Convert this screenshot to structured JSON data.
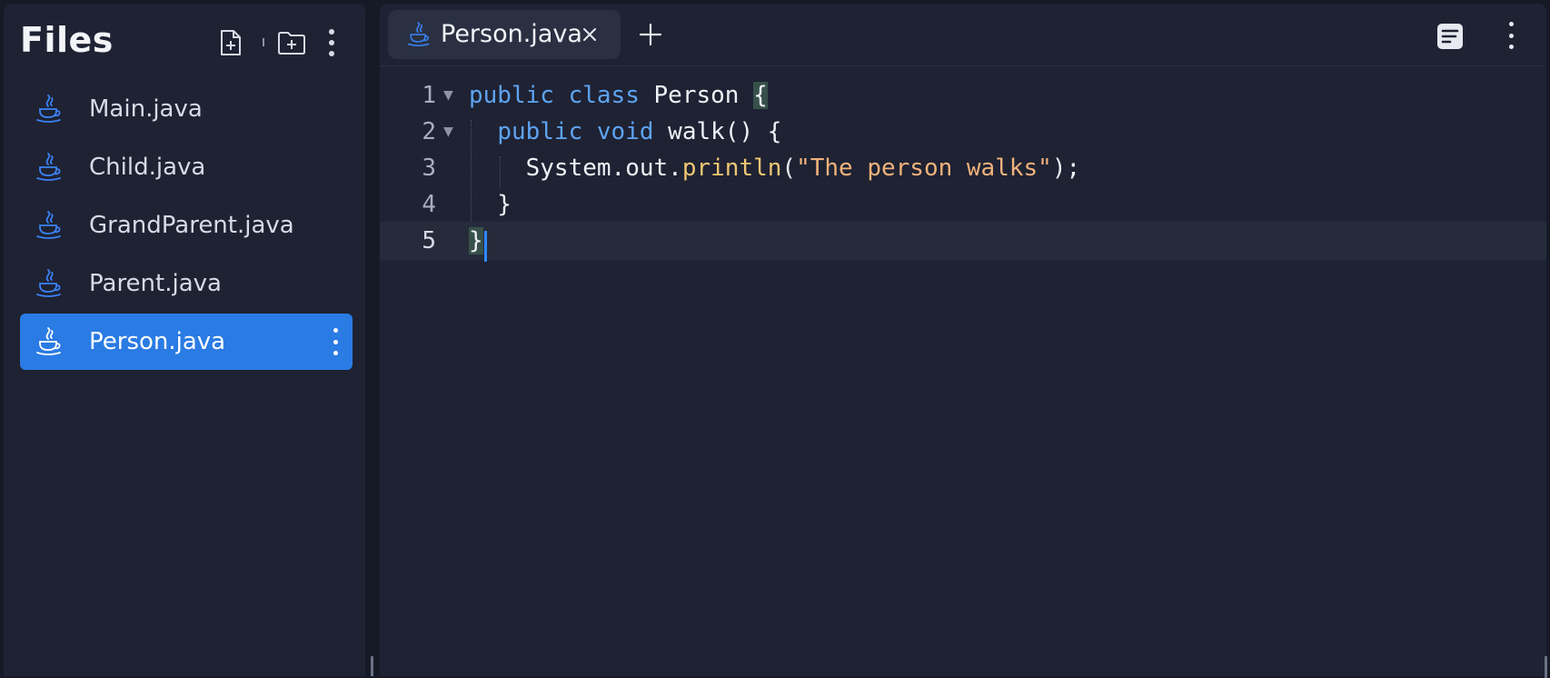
{
  "sidebar": {
    "title": "Files",
    "toolbar": {
      "new_file_icon": "new-file-icon",
      "new_folder_icon": "new-folder-icon",
      "more_icon": "kebab-icon"
    },
    "files": [
      {
        "name": "Main.java",
        "icon": "java-icon"
      },
      {
        "name": "Child.java",
        "icon": "java-icon"
      },
      {
        "name": "GrandParent.java",
        "icon": "java-icon"
      },
      {
        "name": "Parent.java",
        "icon": "java-icon"
      },
      {
        "name": "Person.java",
        "icon": "java-icon",
        "selected": true
      }
    ]
  },
  "editor": {
    "tabs": [
      {
        "label": "Person.java",
        "icon": "java-icon",
        "active": true
      }
    ],
    "toolbar": {
      "new_tab_icon": "plus-icon",
      "format_icon": "format-icon",
      "more_icon": "kebab-icon"
    },
    "line_numbers": [
      "1",
      "2",
      "3",
      "4",
      "5"
    ],
    "code_lines": [
      "public class Person {",
      "  public void walk() {",
      "    System.out.println(\"The person walks\");",
      "  }",
      "}"
    ],
    "tokens": {
      "public": "public",
      "class": "class",
      "void": "void",
      "class_name": "Person",
      "method_name": "walk",
      "system": "System",
      "out": "out",
      "println": "println",
      "string_literal": "\"The person walks\""
    },
    "active_line": 5
  },
  "colors": {
    "background": "#1e2233",
    "selected_item": "#2a7be4",
    "keyword": "#5ea3f0",
    "function": "#f0c674",
    "string": "#f2b27c",
    "cursor": "#2f88ff"
  }
}
